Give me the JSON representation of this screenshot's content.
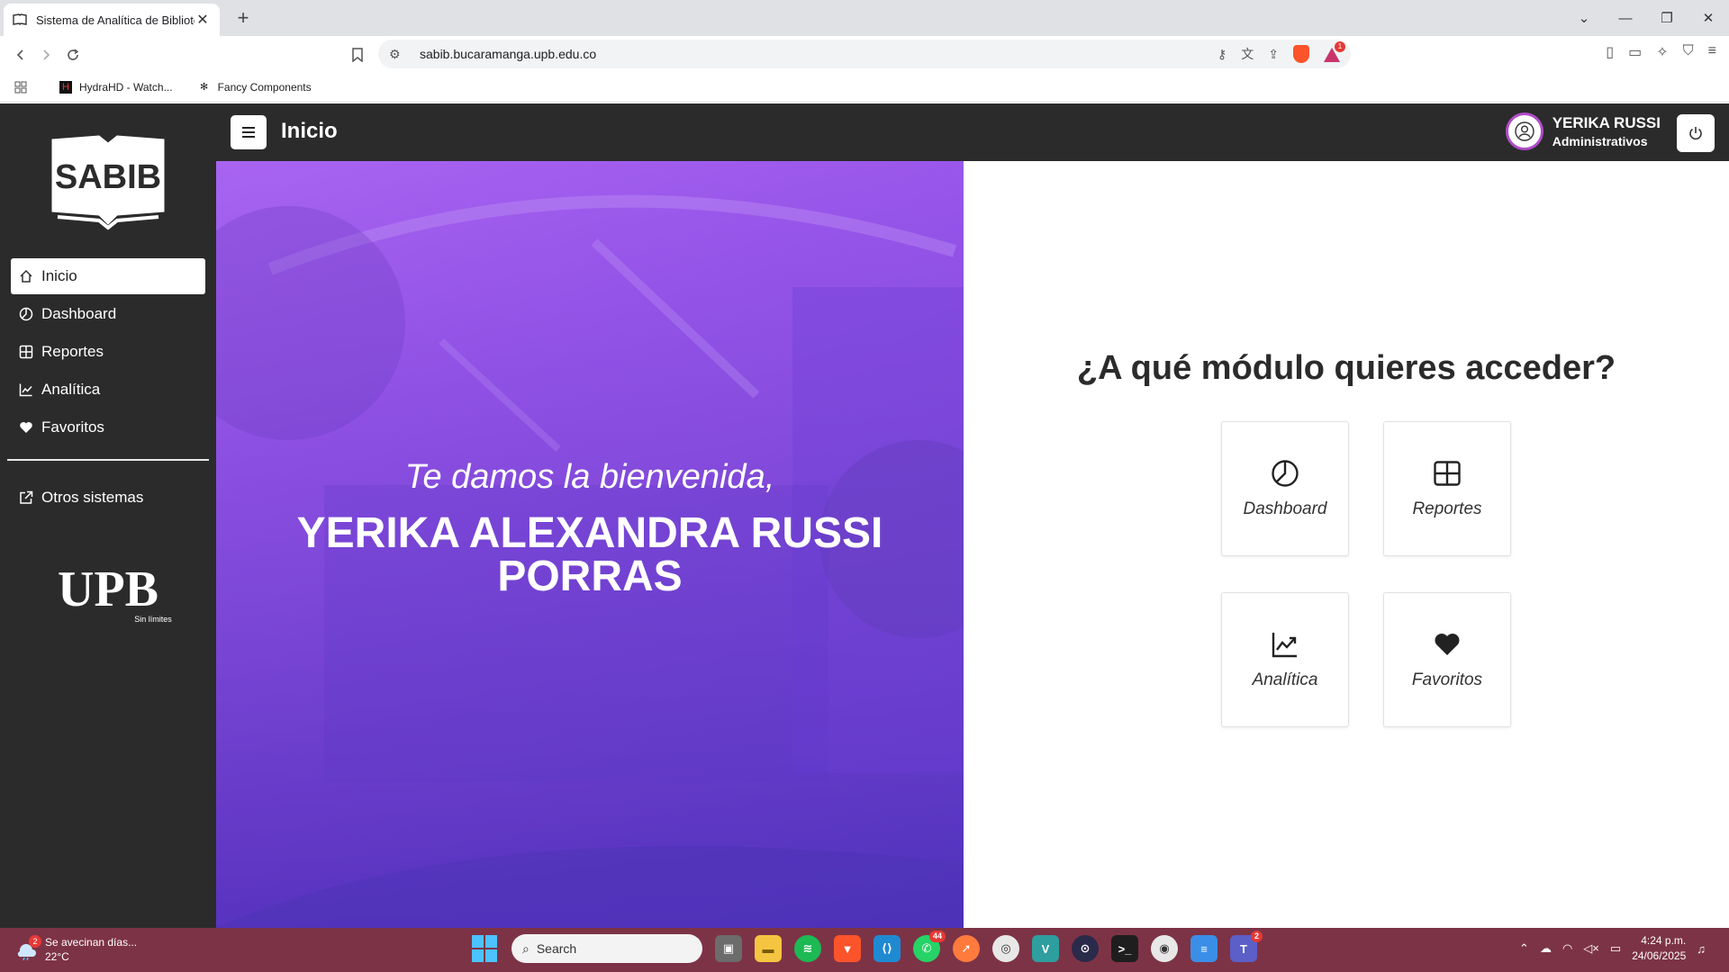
{
  "browser": {
    "tab_title": "Sistema de Analítica de Bibliotec",
    "url": "sabib.bucaramanga.upb.edu.co",
    "bookmarks": [
      {
        "label": "HydraHD - Watch..."
      },
      {
        "label": "Fancy Components"
      }
    ]
  },
  "sidebar": {
    "logo_text": "SABIB",
    "items": [
      {
        "label": "Inicio",
        "icon": "home-icon",
        "active": true
      },
      {
        "label": "Dashboard",
        "icon": "pie-chart-icon"
      },
      {
        "label": "Reportes",
        "icon": "grid-icon"
      },
      {
        "label": "Analítica",
        "icon": "trend-chart-icon"
      },
      {
        "label": "Favoritos",
        "icon": "heart-icon"
      }
    ],
    "other_systems": "Otros sistemas",
    "university_logo": "UPB",
    "university_tagline": "Sin límites"
  },
  "header": {
    "title": "Inicio",
    "user_name": "YERIKA RUSSI",
    "user_role": "Administrativos"
  },
  "hero": {
    "greeting": "Te damos la bienvenida,",
    "full_name": "YERIKA ALEXANDRA RUSSI PORRAS"
  },
  "modules": {
    "title": "¿A qué módulo quieres acceder?",
    "cards": [
      {
        "label": "Dashboard",
        "icon": "pie-chart-icon"
      },
      {
        "label": "Reportes",
        "icon": "grid-icon"
      },
      {
        "label": "Analítica",
        "icon": "trend-chart-icon"
      },
      {
        "label": "Favoritos",
        "icon": "heart-icon"
      }
    ]
  },
  "taskbar": {
    "weather_text": "Se avecinan días...",
    "weather_temp": "22°C",
    "weather_badge": "2",
    "search_placeholder": "Search",
    "whatsapp_badge": "44",
    "teams_badge": "2",
    "time": "4:24 p.m.",
    "date": "24/06/2025"
  },
  "colors": {
    "sidebar_bg": "#2b2b2b",
    "hero_purple": "#8f48e6",
    "taskbar_bg": "#7d3346",
    "avatar_ring": "#b04cc9"
  }
}
